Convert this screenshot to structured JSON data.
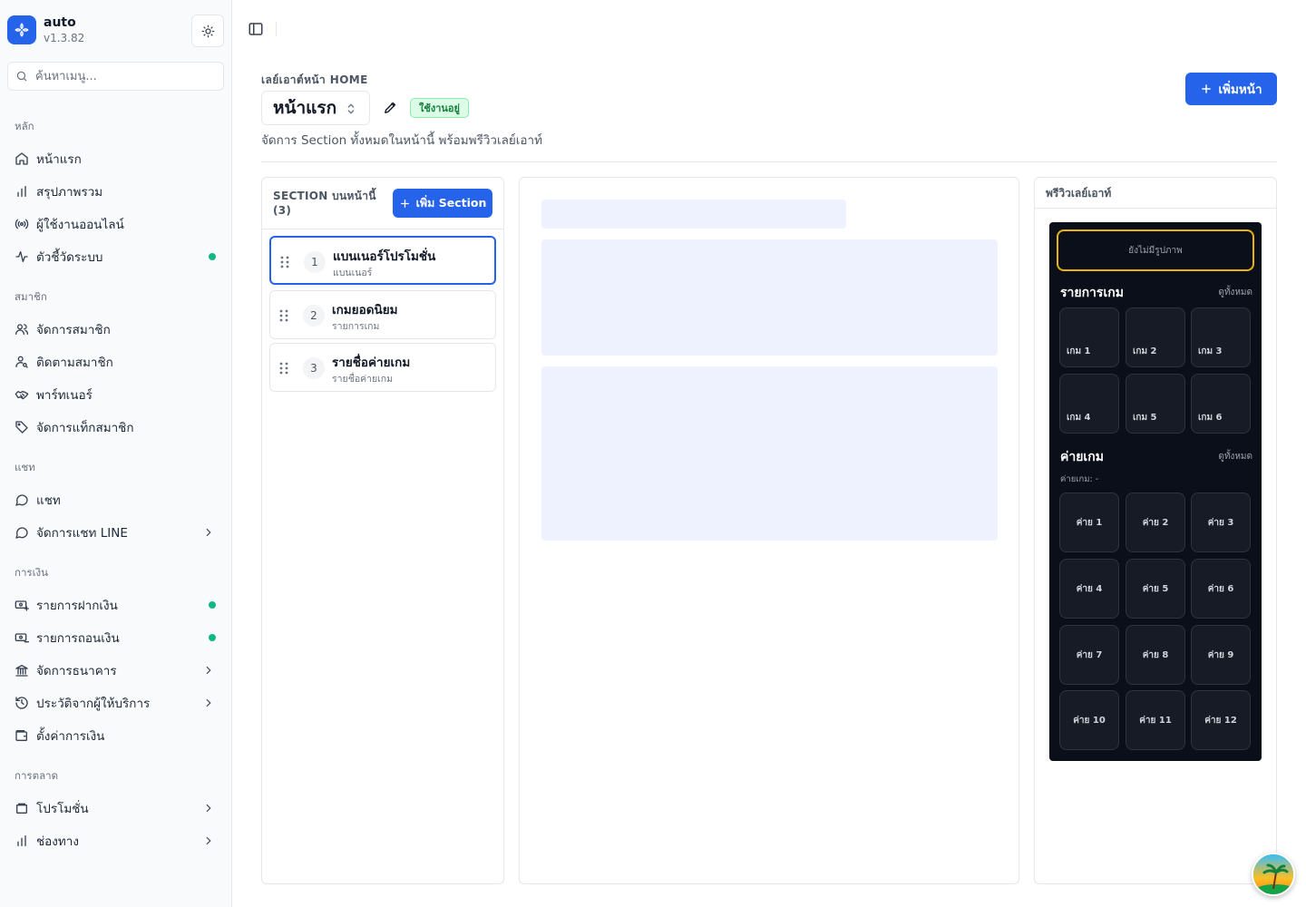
{
  "brand": {
    "name": "auto",
    "version": "v1.3.82"
  },
  "search": {
    "placeholder": "ค้นหาเมนู..."
  },
  "sidebar": {
    "groups": [
      {
        "label": "หลัก",
        "items": [
          {
            "label": "หน้าแรก",
            "icon": "home-icon"
          },
          {
            "label": "สรุปภาพรวม",
            "icon": "bar-chart-icon"
          },
          {
            "label": "ผู้ใช้งานออนไลน์",
            "icon": "broadcast-icon"
          },
          {
            "label": "ตัวชี้วัดระบบ",
            "icon": "activity-icon",
            "status_dot": true
          }
        ]
      },
      {
        "label": "สมาชิก",
        "items": [
          {
            "label": "จัดการสมาชิก",
            "icon": "users-icon"
          },
          {
            "label": "ติดตามสมาชิก",
            "icon": "user-search-icon"
          },
          {
            "label": "พาร์ทเนอร์",
            "icon": "handshake-icon"
          },
          {
            "label": "จัดการแท็กสมาชิก",
            "icon": "tag-icon"
          }
        ]
      },
      {
        "label": "แชท",
        "items": [
          {
            "label": "แชท",
            "icon": "chat-icon"
          },
          {
            "label": "จัดการแชท LINE",
            "icon": "chat-icon",
            "has_submenu": true
          }
        ]
      },
      {
        "label": "การเงิน",
        "items": [
          {
            "label": "รายการฝากเงิน",
            "icon": "deposit-icon",
            "status_dot": true
          },
          {
            "label": "รายการถอนเงิน",
            "icon": "withdraw-icon",
            "status_dot": true
          },
          {
            "label": "จัดการธนาคาร",
            "icon": "bank-icon",
            "has_submenu": true
          },
          {
            "label": "ประวัติจากผู้ให้บริการ",
            "icon": "history-icon",
            "has_submenu": true
          },
          {
            "label": "ตั้งค่าการเงิน",
            "icon": "wallet-icon"
          }
        ]
      },
      {
        "label": "การตลาด",
        "items": [
          {
            "label": "โปรโมชั่น",
            "icon": "wallet-icon",
            "has_submenu": true
          },
          {
            "label": "ช่องทาง",
            "icon": "bar-chart-icon",
            "has_submenu": true
          }
        ]
      }
    ]
  },
  "header": {
    "eyebrow": "เลย์เอาต์หน้า HOME",
    "page_name": "หน้าแรก",
    "badge": "ใช้งานอยู่",
    "subtitle": "จัดการ Section ทั้งหมดในหน้านี้ พร้อมพรีวิวเลย์เอาท์",
    "add_page_label": "เพิ่มหน้า"
  },
  "sections_panel": {
    "title": "SECTION บนหน้านี้ (3)",
    "add_label": "เพิ่ม Section",
    "items": [
      {
        "num": "1",
        "name": "แบนเนอร์โปรโมชั่น",
        "type": "แบนเนอร์",
        "active": true
      },
      {
        "num": "2",
        "name": "เกมยอดนิยม",
        "type": "รายการเกม",
        "active": false
      },
      {
        "num": "3",
        "name": "รายชื่อค่ายเกม",
        "type": "รายชื่อค่ายเกม",
        "active": false
      }
    ]
  },
  "preview": {
    "title": "พรีวิวเลย์เอาท์",
    "banner_placeholder": "ยังไม่มีรูปภาพ",
    "games_title": "รายการเกม",
    "games_see_all": "ดูทั้งหมด",
    "games": [
      "เกม 1",
      "เกม 2",
      "เกม 3",
      "เกม 4",
      "เกม 5",
      "เกม 6"
    ],
    "providers_title": "ค่ายเกม",
    "providers_see_all": "ดูทั้งหมด",
    "providers_sub": "ค่ายเกม: -",
    "providers": [
      "ค่าย 1",
      "ค่าย 2",
      "ค่าย 3",
      "ค่าย 4",
      "ค่าย 5",
      "ค่าย 6",
      "ค่าย 7",
      "ค่าย 8",
      "ค่าย 9",
      "ค่าย 10",
      "ค่าย 11",
      "ค่าย 12"
    ]
  },
  "colors": {
    "accent": "#2563eb",
    "status_dot": "#10b981",
    "badge_bg": "#dcfce7",
    "badge_text": "#15803d",
    "phone_bg": "#0b0f19",
    "banner_border": "#eab308"
  }
}
